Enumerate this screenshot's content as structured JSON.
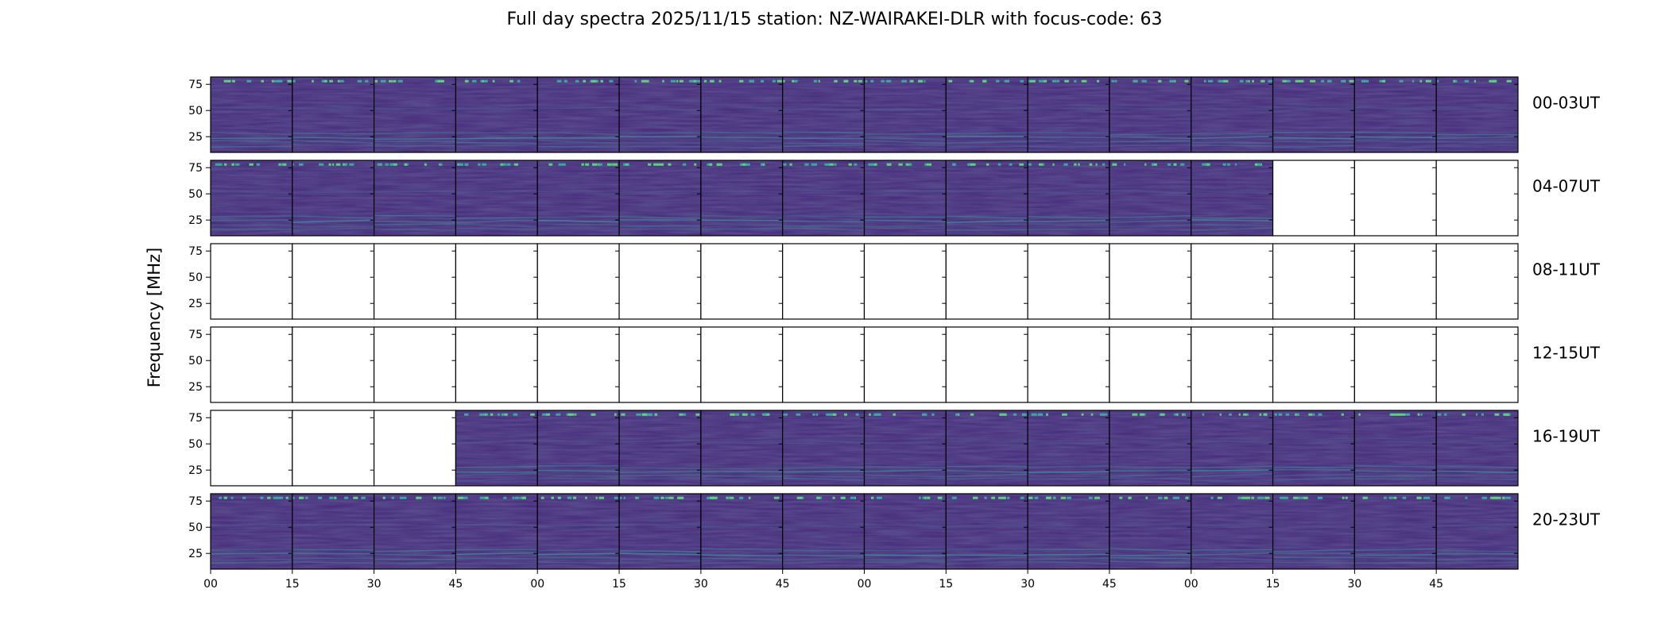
{
  "chart_data": {
    "type": "heatmap",
    "title": "Full day spectra 2025/11/15 station: NZ-WAIRAKEI-DLR with focus-code: 63",
    "ylabel": "Frequency [MHz]",
    "xlabel": "",
    "y_ticks": [
      75,
      50,
      25
    ],
    "ylim": [
      10,
      82
    ],
    "x_tick_labels": [
      "00",
      "15",
      "30",
      "45",
      "00",
      "15",
      "30",
      "45",
      "00",
      "15",
      "30",
      "45",
      "00",
      "15",
      "30",
      "45"
    ],
    "colormap": "viridis",
    "background_color": "#46287a",
    "panels_per_row": 16,
    "panel_minutes": 15,
    "rows": [
      {
        "label": "00-03UT",
        "present": [
          1,
          1,
          1,
          1,
          1,
          1,
          1,
          1,
          1,
          1,
          1,
          1,
          1,
          1,
          1,
          1
        ]
      },
      {
        "label": "04-07UT",
        "present": [
          1,
          1,
          1,
          1,
          1,
          1,
          1,
          1,
          1,
          1,
          1,
          1,
          1,
          0,
          0,
          0
        ]
      },
      {
        "label": "08-11UT",
        "present": [
          0,
          0,
          0,
          0,
          0,
          0,
          0,
          0,
          0,
          0,
          0,
          0,
          0,
          0,
          0,
          0
        ]
      },
      {
        "label": "12-15UT",
        "present": [
          0,
          0,
          0,
          0,
          0,
          0,
          0,
          0,
          0,
          0,
          0,
          0,
          0,
          0,
          0,
          0
        ]
      },
      {
        "label": "16-19UT",
        "present": [
          0,
          0,
          0,
          1,
          1,
          1,
          1,
          1,
          1,
          1,
          1,
          1,
          1,
          1,
          1,
          1
        ]
      },
      {
        "label": "20-23UT",
        "present": [
          1,
          1,
          1,
          1,
          1,
          1,
          1,
          1,
          1,
          1,
          1,
          1,
          1,
          1,
          1,
          1
        ]
      }
    ]
  }
}
